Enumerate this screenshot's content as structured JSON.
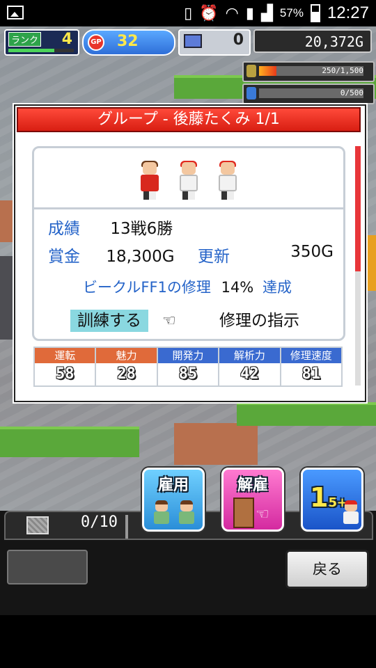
{
  "status_bar": {
    "battery_pct": "57%",
    "time": "12:27"
  },
  "hud": {
    "rank_label": "ランク",
    "rank_value": "4",
    "gp_label": "GP",
    "gp_value": "32",
    "pc_value": "0",
    "money": "20,372G",
    "fuel_gauge": "250/1,500",
    "fuel_fraction": 0.167,
    "tank_gauge": "0/500",
    "tank_fraction": 0
  },
  "dialog": {
    "title": "グループ - 後藤たくみ 1/1",
    "record_label": "成績",
    "record_value": "13戦6勝",
    "prize_label": "賞金",
    "prize_value": "18,300G",
    "renew_label": "更新",
    "renew_value": "350G",
    "repair_task": "ビークルFF1の修理",
    "progress_value": "14%",
    "progress_suffix": "達成",
    "train_button": "訓練する",
    "repair_button": "修理の指示",
    "params": [
      {
        "label": "運転",
        "value": "58",
        "color": "#e06a3a"
      },
      {
        "label": "魅力",
        "value": "28",
        "color": "#e06a3a"
      },
      {
        "label": "開発力",
        "value": "85",
        "color": "#3a6ad0"
      },
      {
        "label": "解析力",
        "value": "42",
        "color": "#3a6ad0"
      },
      {
        "label": "修理速度",
        "value": "81",
        "color": "#3a6ad0"
      }
    ]
  },
  "actions": {
    "hire": "雇用",
    "fire": "解雇",
    "level_main": "1",
    "level_sup": "5+"
  },
  "bottom": {
    "count": "0/10",
    "back_button": "戻る"
  }
}
